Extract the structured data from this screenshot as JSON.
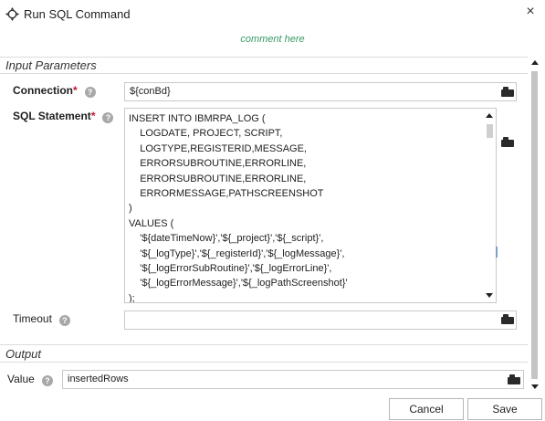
{
  "window": {
    "title": "Run SQL Command",
    "close_label": "×",
    "comment": "comment here"
  },
  "input_parameters": {
    "title": "Input Parameters",
    "connection": {
      "label": "Connection",
      "required_mark": "*",
      "help": "?",
      "value": "${conBd}"
    },
    "sql_statement": {
      "label": "SQL Statement",
      "required_mark": "*",
      "help": "?",
      "value": "INSERT INTO IBMRPA_LOG (\n    LOGDATE, PROJECT, SCRIPT,\n    LOGTYPE,REGISTERID,MESSAGE,\n    ERRORSUBROUTINE,ERRORLINE,\n    ERRORSUBROUTINE,ERRORLINE,\n    ERRORMESSAGE,PATHSCREENSHOT\n)\nVALUES (\n    '${dateTimeNow}','${_project}','${_script}',\n    '${_logType}','${_registerId}','${_logMessage}',\n    '${_logErrorSubRoutine}','${_logErrorLine}',\n    '${_logErrorMessage}','${_logPathScreenshot}'\n);"
    },
    "timeout": {
      "label": "Timeout",
      "help": "?",
      "value": ""
    }
  },
  "output": {
    "title": "Output",
    "value": {
      "label": "Value",
      "help": "?",
      "value": "insertedRows"
    }
  },
  "buttons": {
    "cancel": "Cancel",
    "save": "Save"
  }
}
